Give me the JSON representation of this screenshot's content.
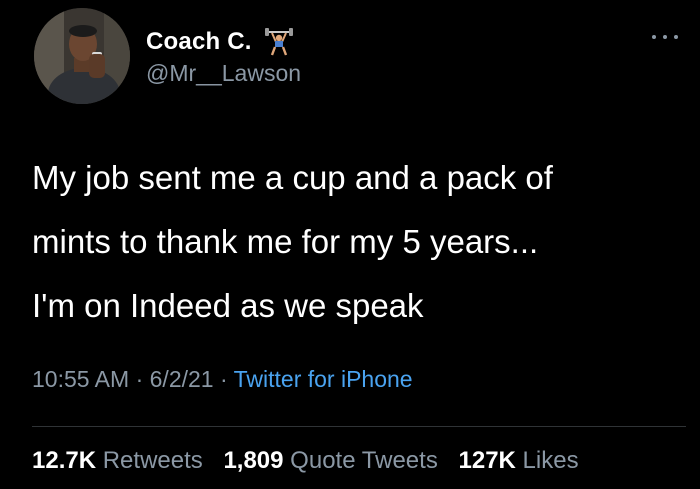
{
  "author": {
    "display_name": "Coach C.",
    "handle": "@Mr__Lawson",
    "name_emoji": "weightlifter-emoji"
  },
  "more_menu": {
    "icon": "more-horizontal-icon"
  },
  "tweet": {
    "lines": [
      "My job sent me a cup and a pack of",
      "mints to thank me for my 5 years...",
      "I'm on Indeed as we speak"
    ]
  },
  "meta": {
    "time": "10:55 AM",
    "sep1": " · ",
    "date": "6/2/21",
    "sep2": " · ",
    "source": "Twitter for iPhone",
    "source_color": "#4aa3f0"
  },
  "stats": {
    "retweets_count": "12.7K",
    "retweets_label": "Retweets",
    "quote_count": "1,809",
    "quote_label": "Quote Tweets",
    "likes_count": "127K",
    "likes_label": "Likes"
  }
}
